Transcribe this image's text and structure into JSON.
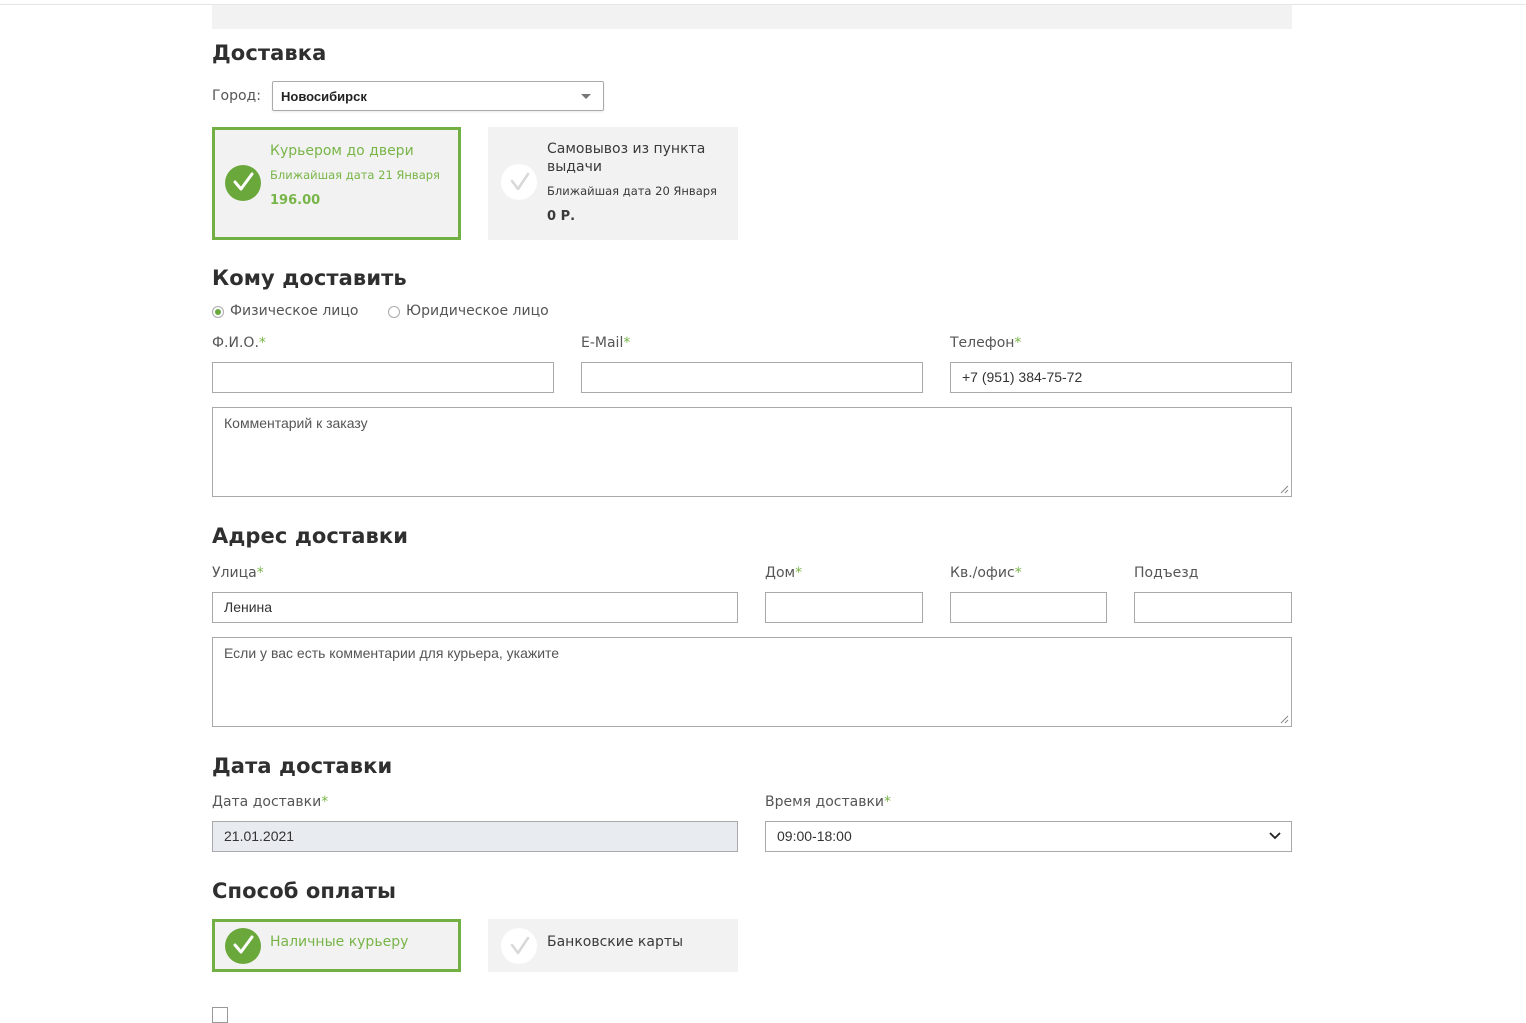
{
  "delivery": {
    "heading": "Доставка",
    "city_label": "Город:",
    "city_value": "Новосибирск",
    "options": [
      {
        "title": "Курьером до двери",
        "date": "Ближайшая дата 21 Января",
        "price": "196.00",
        "selected": true
      },
      {
        "title": "Самовывоз из пункта выдачи",
        "date": "Ближайшая дата 20 Января",
        "price": "0 Р.",
        "selected": false
      }
    ]
  },
  "recipient": {
    "heading": "Кому доставить",
    "types": [
      {
        "label": "Физическое лицо",
        "checked": true
      },
      {
        "label": "Юридическое лицо",
        "checked": false
      }
    ],
    "fio_label": "Ф.И.О.",
    "email_label": "E-Mail",
    "phone_label": "Телефон",
    "required_mark": "*",
    "fio_value": "",
    "email_value": "",
    "phone_value": "+7 (951) 384-75-72",
    "comment_placeholder": "Комментарий к заказу"
  },
  "address": {
    "heading": "Адрес доставки",
    "street_label": "Улица",
    "house_label": "Дом",
    "apt_label": "Кв./офис",
    "entrance_label": "Подъезд",
    "street_value": "Ленина",
    "house_value": "",
    "apt_value": "",
    "entrance_value": "",
    "courier_comment_placeholder": "Если у вас есть комментарии для курьера, укажите"
  },
  "date": {
    "heading": "Дата доставки",
    "date_label": "Дата доставки",
    "time_label": "Время доставки",
    "date_value": "21.01.2021",
    "time_value": "09:00-18:00"
  },
  "payment": {
    "heading": "Способ оплаты",
    "options": [
      {
        "title": "Наличные курьеру",
        "selected": true
      },
      {
        "title": "Банковские карты",
        "selected": false
      }
    ]
  },
  "colors": {
    "accent": "#72b043",
    "card_bg": "#f3f2f2",
    "required": "#78b548"
  }
}
